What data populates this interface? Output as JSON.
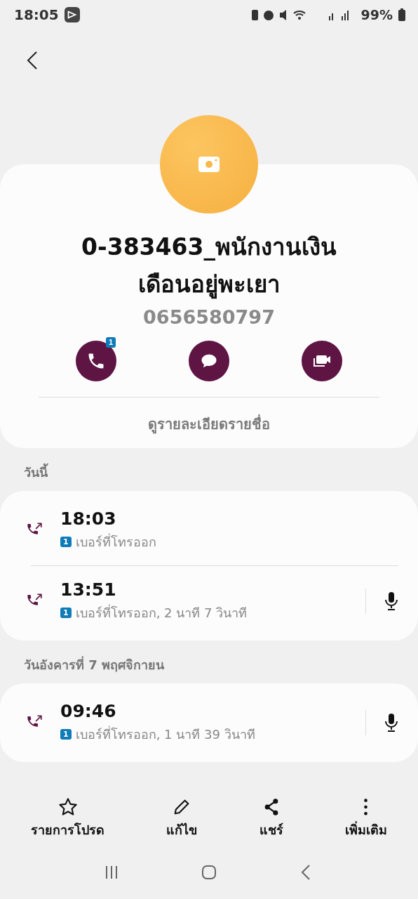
{
  "status_bar": {
    "time": "18:05",
    "battery": "99%"
  },
  "contact": {
    "name": "0-383463_พนักงานเงินเดือนอยู่พะเยา",
    "number": "0656580797",
    "call_badge": "1",
    "details_link": "ดูรายละเอียดรายชื่อ"
  },
  "call_log": [
    {
      "heading": "วันนี้",
      "calls": [
        {
          "time": "18:03",
          "sim": "1",
          "detail": "เบอร์ที่โทรออก",
          "has_recording": false
        },
        {
          "time": "13:51",
          "sim": "1",
          "detail": "เบอร์ที่โทรออก, 2 นาที 7 วินาที",
          "has_recording": true
        }
      ]
    },
    {
      "heading": "วันอังคารที่ 7 พฤศจิกายน",
      "calls": [
        {
          "time": "09:46",
          "sim": "1",
          "detail": "เบอร์ที่โทรออก, 1 นาที 39 วินาที",
          "has_recording": true
        }
      ]
    }
  ],
  "bottom_actions": [
    {
      "kind": "favorite",
      "label": "รายการโปรด"
    },
    {
      "kind": "edit",
      "label": "แก้ไข"
    },
    {
      "kind": "share",
      "label": "แชร์"
    },
    {
      "kind": "more",
      "label": "เพิ่มเติม"
    }
  ]
}
